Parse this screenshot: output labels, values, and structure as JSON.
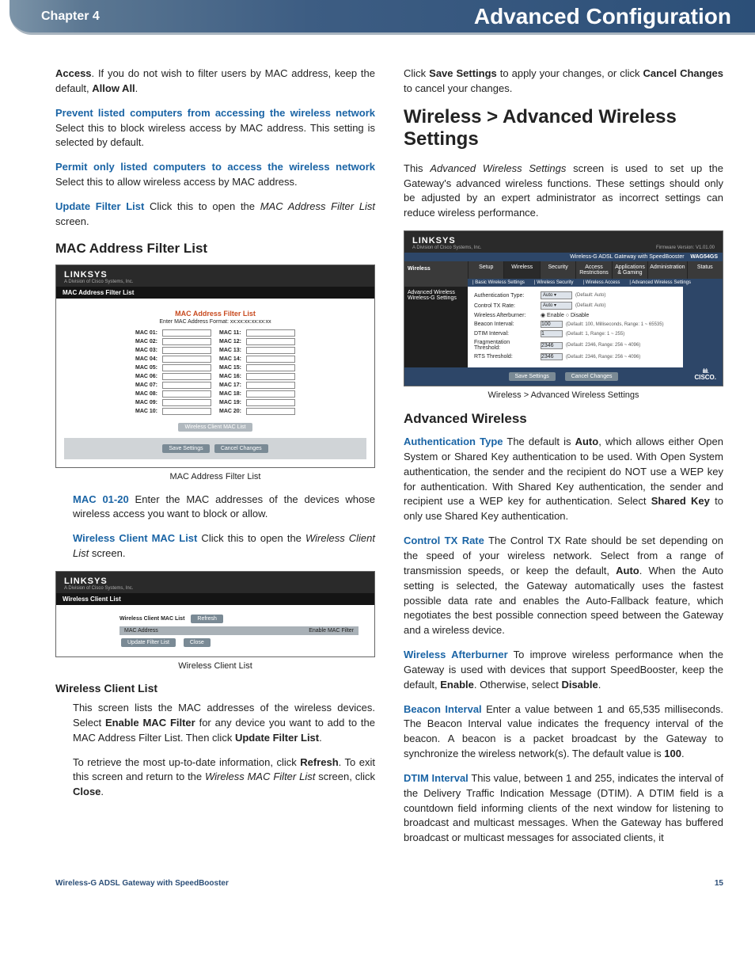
{
  "banner": {
    "chapter": "Chapter 4",
    "title": "Advanced Configuration"
  },
  "left": {
    "p1a": "Access",
    "p1b": ". If you do not wish to filter users by MAC address, keep the default, ",
    "p1c": "Allow All",
    "p1d": ".",
    "p2a": "Prevent listed computers from accessing the wireless network",
    "p2b": "  Select this to block wireless access by MAC address. This setting is selected by default.",
    "p3a": "Permit only listed computers to access the wireless network",
    "p3b": "  Select this to allow wireless access by MAC address.",
    "p4a": "Update Filter List",
    "p4b": "  Click this to open the ",
    "p4c": "MAC Address Filter List",
    "p4d": " screen.",
    "h_mac": "MAC Address Filter List",
    "shot1": {
      "brand": "LINKSYS",
      "brand_sub": "A Division of Cisco Systems, Inc.",
      "tab": "MAC Address Filter List",
      "title": "MAC Address Filter List",
      "format": "Enter MAC Address Format: xx:xx:xx:xx:xx:xx",
      "rows_left": [
        "MAC 01:",
        "MAC 02:",
        "MAC 03:",
        "MAC 04:",
        "MAC 05:",
        "MAC 06:",
        "MAC 07:",
        "MAC 08:",
        "MAC 09:",
        "MAC 10:"
      ],
      "rows_right": [
        "MAC 11:",
        "MAC 12:",
        "MAC 13:",
        "MAC 14:",
        "MAC 15:",
        "MAC 16:",
        "MAC 17:",
        "MAC 18:",
        "MAC 19:",
        "MAC 20:"
      ],
      "btn_wcl": "Wireless Client MAC List",
      "btn_save": "Save Settings",
      "btn_cancel": "Cancel Changes"
    },
    "cap1": "MAC Address Filter List",
    "p5a": "MAC 01-20",
    "p5b": "  Enter the MAC addresses of the devices whose wireless access you want to block or allow.",
    "p6a": "Wireless Client MAC List",
    "p6b": "  Click this to open the ",
    "p6c": "Wireless Client List",
    "p6d": " screen.",
    "shot2": {
      "brand": "LINKSYS",
      "brand_sub": "A Division of Cisco Systems, Inc.",
      "tab": "Wireless Client List",
      "h_list": "Wireless Client MAC List",
      "btn_refresh": "Refresh",
      "col1": "MAC Address",
      "col2": "Enable MAC Filter",
      "btn_update": "Update Filter List",
      "btn_close": "Close"
    },
    "cap2": "Wireless Client List",
    "h_wcl": "Wireless Client List",
    "p7a": "This screen lists the MAC addresses of the wireless devices. Select ",
    "p7b": "Enable MAC Filter",
    "p7c": " for any device you want to add to the MAC Address Filter List. Then click ",
    "p7d": "Update Filter List",
    "p7e": ".",
    "p8a": "To retrieve the most up-to-date information, click ",
    "p8b": "Refresh",
    "p8c": ". To exit this screen and return to the ",
    "p8d": "Wireless MAC Filter List",
    "p8e": " screen, click ",
    "p8f": "Close",
    "p8g": "."
  },
  "right": {
    "p1a": "Click ",
    "p1b": "Save Settings",
    "p1c": " to apply your changes, or click ",
    "p1d": "Cancel Changes",
    "p1e": " to cancel your changes.",
    "h_section": "Wireless > Advanced Wireless Settings",
    "p2a": "This ",
    "p2b": "Advanced Wireless Settings",
    "p2c": " screen is used to set up the Gateway's advanced wireless functions. These settings should only be adjusted by an expert administrator as incorrect settings can reduce wireless performance.",
    "shot3": {
      "brand": "LINKSYS",
      "brand_sub": "A Division of Cisco Systems, Inc.",
      "firmware": "Firmware Version: V1.01.00",
      "product": "Wireless-G ADSL Gateway with SpeedBooster",
      "model": "WAG54GS",
      "left_label": "Wireless",
      "tabs": [
        "Setup",
        "Wireless",
        "Security",
        "Access Restrictions",
        "Applications & Gaming",
        "Administration",
        "Status"
      ],
      "subtabs": [
        "Basic Wireless Settings",
        "Wireless Security",
        "Wireless Access",
        "Advanced Wireless Settings"
      ],
      "sidebar1": "Advanced Wireless",
      "sidebar2": "Wireless-G Settings",
      "rows": [
        {
          "l": "Authentication Type:",
          "sel": "Auto",
          "hint": "(Default: Auto)"
        },
        {
          "l": "Control TX Rate:",
          "sel": "Auto",
          "hint": "(Default: Auto)"
        },
        {
          "l": "Wireless Afterburner:",
          "radio": "Enable  Disable"
        },
        {
          "l": "Beacon Interval:",
          "val": "100",
          "hint": "(Default: 100, Milliseconds, Range: 1 ~ 65535)"
        },
        {
          "l": "DTIM Interval:",
          "val": "1",
          "hint": "(Default: 1, Range: 1 ~ 255)"
        },
        {
          "l": "Fragmentation Threshold:",
          "val": "2346",
          "hint": "(Default: 2346, Range: 256 ~ 4096)"
        },
        {
          "l": "RTS Threshold:",
          "val": "2346",
          "hint": "(Default: 2346, Range: 256 ~ 4096)"
        }
      ],
      "btn_save": "Save Settings",
      "btn_cancel": "Cancel Changes",
      "cisco": "CISCO."
    },
    "cap3": "Wireless > Advanced Wireless Settings",
    "h_aw": "Advanced Wireless",
    "p3a": "Authentication Type",
    "p3b": "  The default is ",
    "p3c": "Auto",
    "p3d": ", which allows either Open System or Shared Key authentication to be used. With Open System authentication, the sender and the recipient do NOT use a WEP key for authentication. With Shared Key authentication, the sender and recipient use a WEP key for authentication. Select ",
    "p3e": "Shared Key",
    "p3f": " to only use Shared Key authentication.",
    "p4a": "Control TX Rate",
    "p4b": "  The Control TX Rate should be set depending on the speed of your wireless network. Select from a range of transmission speeds, or keep the default, ",
    "p4c": "Auto",
    "p4d": ". When the Auto setting is selected, the Gateway automatically uses the fastest possible data rate and enables the Auto-Fallback feature, which negotiates the best possible connection speed between the Gateway and a wireless device.",
    "p5a": "Wireless Afterburner",
    "p5b": "  To improve wireless performance when the Gateway is used with devices that support SpeedBooster, keep the default, ",
    "p5c": "Enable",
    "p5d": ". Otherwise, select ",
    "p5e": "Disable",
    "p5f": ".",
    "p6a": "Beacon Interval",
    "p6b": "  Enter a value between 1 and 65,535 milliseconds. The Beacon Interval value indicates the frequency interval of the beacon. A beacon is a packet broadcast by the Gateway to synchronize the wireless network(s). The default value is ",
    "p6c": "100",
    "p6d": ".",
    "p7a": "DTIM Interval",
    "p7b": "  This value, between 1 and 255, indicates the interval of the Delivery Traffic Indication Message (DTIM). A DTIM field is a countdown field informing clients of the next window for listening to broadcast and multicast messages. When the Gateway has buffered broadcast or multicast messages for associated clients, it"
  },
  "footer": {
    "product": "Wireless-G ADSL Gateway with SpeedBooster",
    "page": "15"
  }
}
